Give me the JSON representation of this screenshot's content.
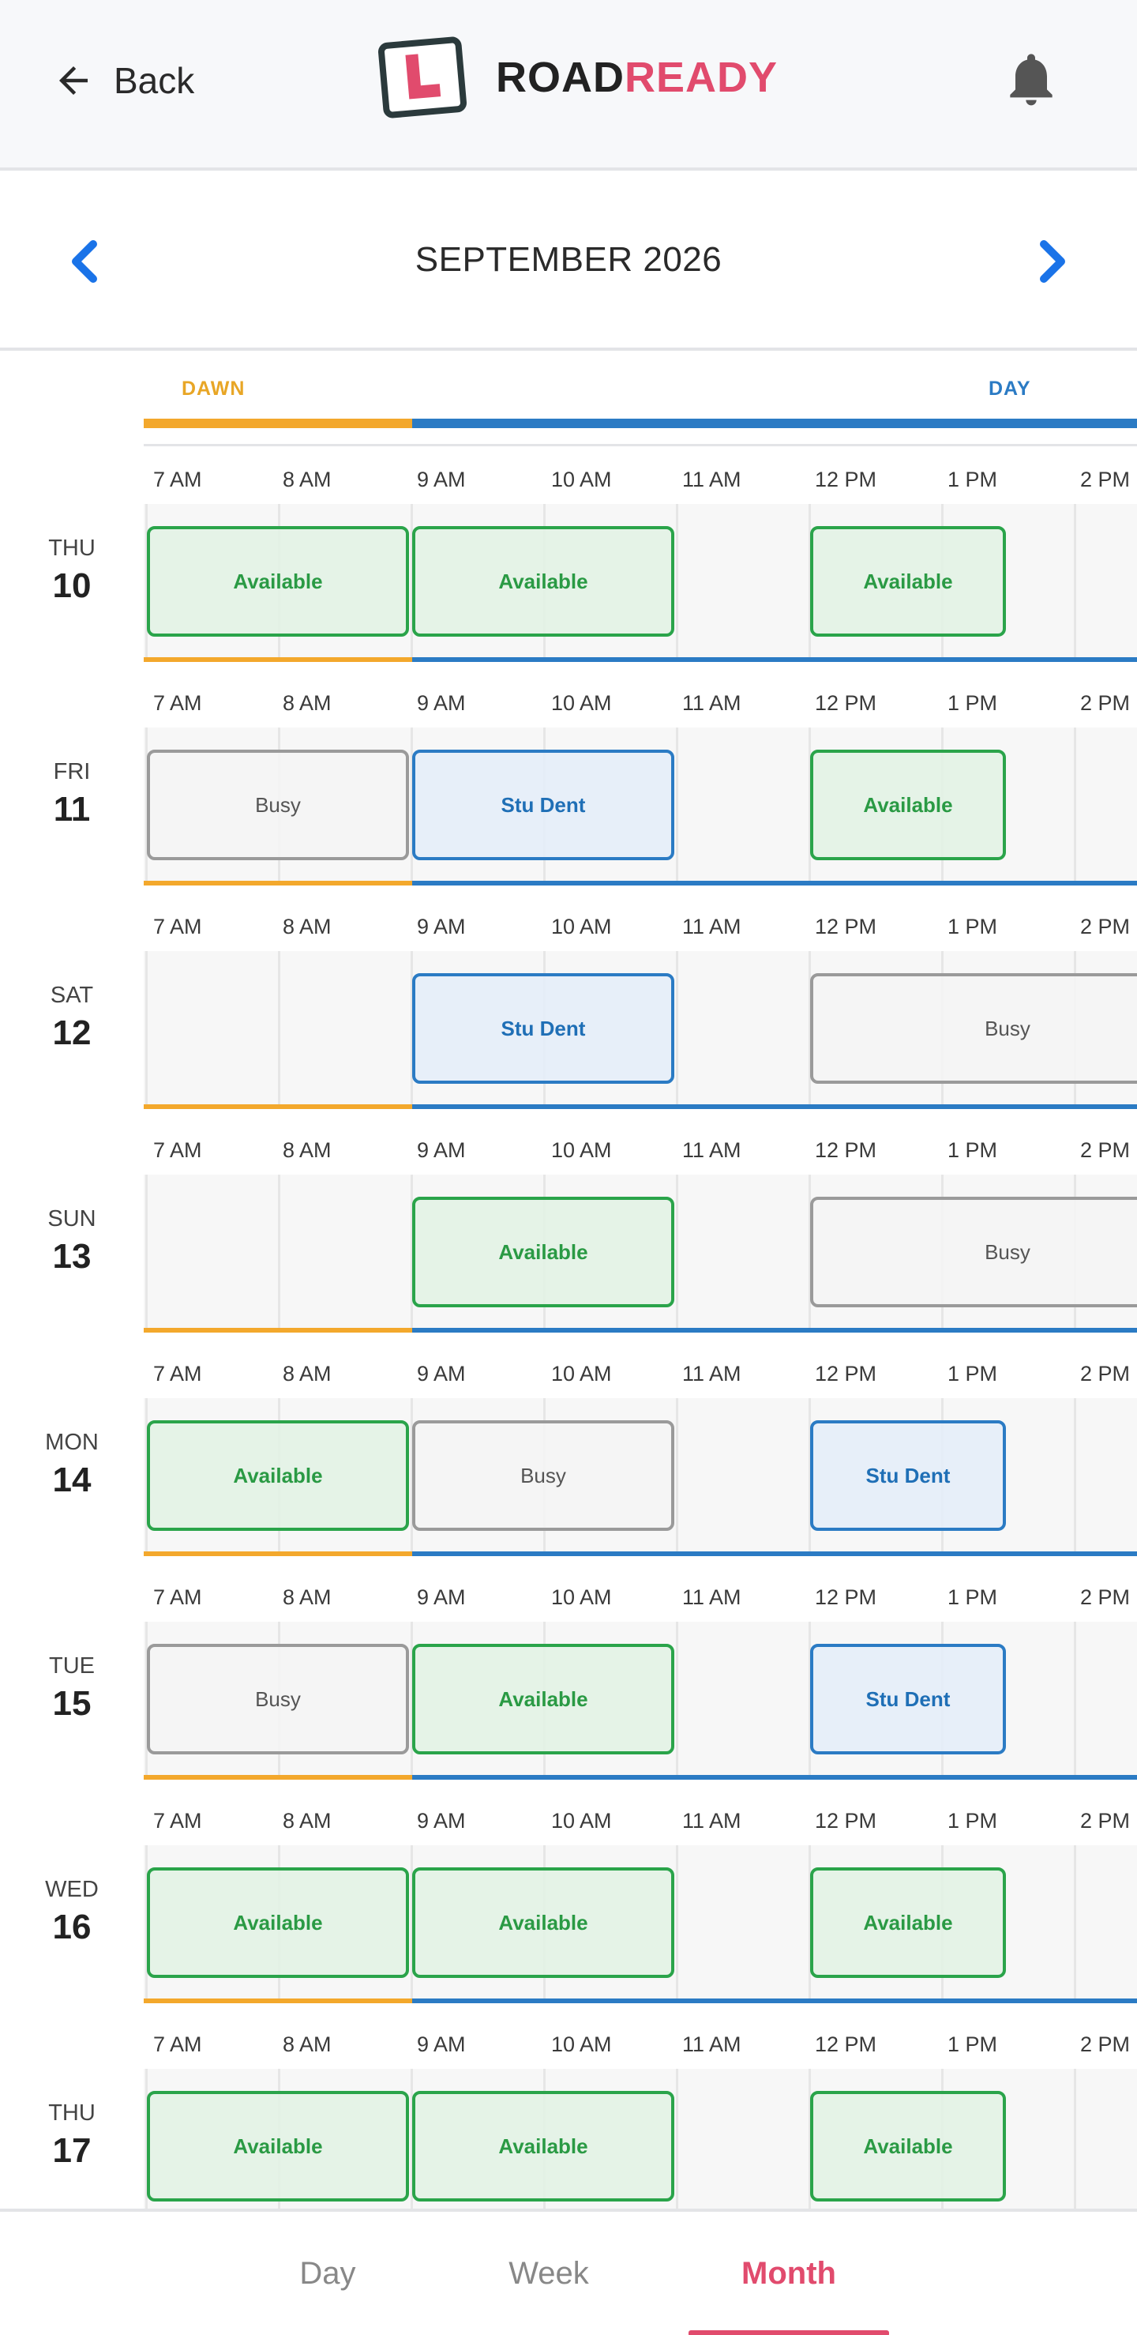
{
  "header": {
    "back_label": "Back",
    "brand_part1": "ROAD",
    "brand_part2": "READY",
    "brand_color": "#e14b6d",
    "icons": [
      "arrow-left-icon",
      "license-plate-logo-icon",
      "bell-icon"
    ]
  },
  "month_nav": {
    "title": "SEPTEMBER 2026",
    "accent": "#1a73e8"
  },
  "periods": {
    "dawn_label": "DAWN",
    "day_label": "DAY",
    "dawn_color": "#f3a82c",
    "day_color": "#2b7bc4"
  },
  "hours": [
    "7 AM",
    "8 AM",
    "9 AM",
    "10 AM",
    "11 AM",
    "12 PM",
    "1 PM",
    "2 PM"
  ],
  "status_colors": {
    "available": "#2aa44a",
    "busy": "#9a9a9a",
    "booked": "#2b7bc4"
  },
  "days": [
    {
      "name": "THU",
      "num": "10",
      "slots": [
        {
          "label": "Available",
          "status": "available",
          "start": 7,
          "end": 9
        },
        {
          "label": "Available",
          "status": "available",
          "start": 9,
          "end": 11
        },
        {
          "label": "Available",
          "status": "available",
          "start": 12,
          "end": 13.5
        }
      ]
    },
    {
      "name": "FRI",
      "num": "11",
      "slots": [
        {
          "label": "Busy",
          "status": "busy",
          "start": 7,
          "end": 9
        },
        {
          "label": "Stu Dent",
          "status": "booked",
          "start": 9,
          "end": 11
        },
        {
          "label": "Available",
          "status": "available",
          "start": 12,
          "end": 13.5
        }
      ]
    },
    {
      "name": "SAT",
      "num": "12",
      "slots": [
        {
          "label": "Stu Dent",
          "status": "booked",
          "start": 9,
          "end": 11
        },
        {
          "label": "Busy",
          "status": "busy",
          "start": 12,
          "end": 15
        }
      ]
    },
    {
      "name": "SUN",
      "num": "13",
      "slots": [
        {
          "label": "Available",
          "status": "available",
          "start": 9,
          "end": 11
        },
        {
          "label": "Busy",
          "status": "busy",
          "start": 12,
          "end": 15
        }
      ]
    },
    {
      "name": "MON",
      "num": "14",
      "slots": [
        {
          "label": "Available",
          "status": "available",
          "start": 7,
          "end": 9
        },
        {
          "label": "Busy",
          "status": "busy",
          "start": 9,
          "end": 11
        },
        {
          "label": "Stu Dent",
          "status": "booked",
          "start": 12,
          "end": 13.5
        }
      ]
    },
    {
      "name": "TUE",
      "num": "15",
      "slots": [
        {
          "label": "Busy",
          "status": "busy",
          "start": 7,
          "end": 9
        },
        {
          "label": "Available",
          "status": "available",
          "start": 9,
          "end": 11
        },
        {
          "label": "Stu Dent",
          "status": "booked",
          "start": 12,
          "end": 13.5
        }
      ]
    },
    {
      "name": "WED",
      "num": "16",
      "slots": [
        {
          "label": "Available",
          "status": "available",
          "start": 7,
          "end": 9
        },
        {
          "label": "Available",
          "status": "available",
          "start": 9,
          "end": 11
        },
        {
          "label": "Available",
          "status": "available",
          "start": 12,
          "end": 13.5
        }
      ]
    },
    {
      "name": "THU",
      "num": "17",
      "slots": [
        {
          "label": "Available",
          "status": "available",
          "start": 7,
          "end": 9
        },
        {
          "label": "Available",
          "status": "available",
          "start": 9,
          "end": 11
        },
        {
          "label": "Available",
          "status": "available",
          "start": 12,
          "end": 13.5
        }
      ]
    }
  ],
  "tabs": {
    "day": "Day",
    "week": "Week",
    "month": "Month",
    "selected": "Month"
  }
}
